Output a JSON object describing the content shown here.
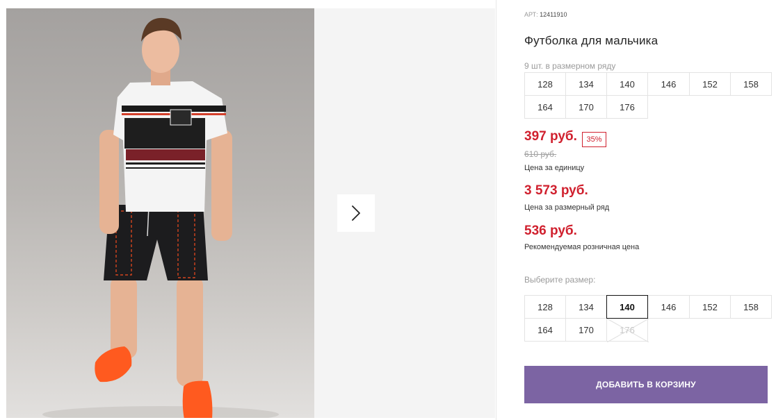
{
  "product": {
    "article_label": "АРТ:",
    "article_number": "12411910",
    "title": "Футболка для мальчика"
  },
  "size_row": {
    "caption": "9 шт. в размерном ряду",
    "sizes": [
      "128",
      "134",
      "140",
      "146",
      "152",
      "158",
      "164",
      "170",
      "176"
    ]
  },
  "pricing": {
    "unit_price": "397 руб.",
    "discount": "35%",
    "old_price": "610 руб.",
    "unit_label": "Цена за единицу",
    "row_price": "3 573 руб.",
    "row_label": "Цена за размерный ряд",
    "retail_price": "536 руб.",
    "retail_label": "Рекомендуемая розничная цена"
  },
  "size_picker": {
    "label": "Выберите размер:",
    "sizes": [
      "128",
      "134",
      "140",
      "146",
      "152",
      "158",
      "164",
      "170",
      "176"
    ],
    "selected": "140",
    "unavailable": [
      "176"
    ]
  },
  "cart": {
    "button_label": "ДОБАВИТЬ В КОРЗИНУ"
  },
  "colors": {
    "price_red": "#d0202e",
    "button_purple": "#7c64a3"
  },
  "icons": {
    "next": "chevron-right-icon"
  }
}
